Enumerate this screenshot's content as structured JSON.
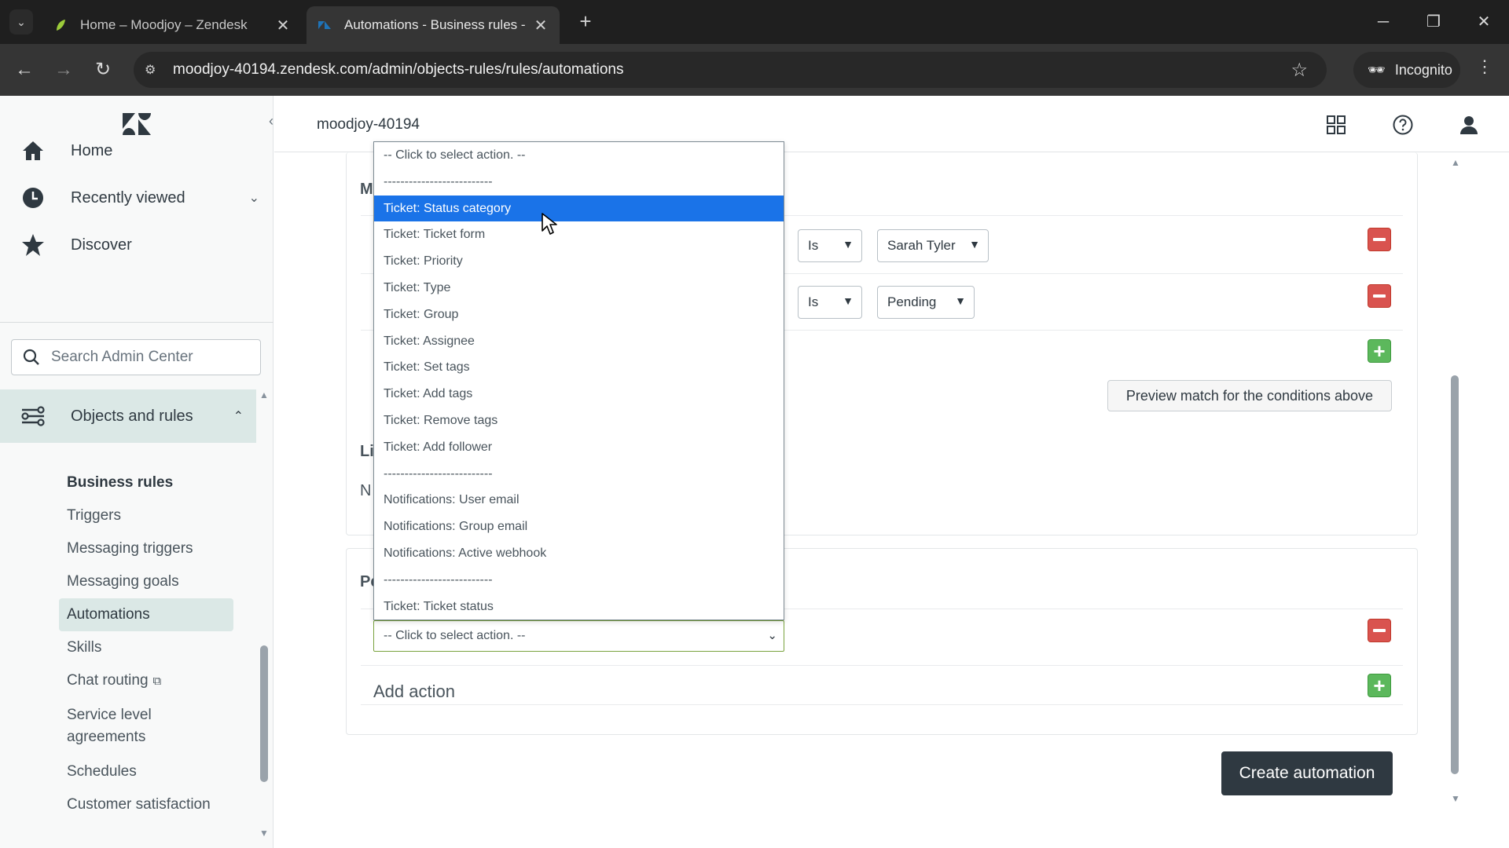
{
  "browser": {
    "tabs": [
      {
        "title": "Home – Moodjoy – Zendesk",
        "active": false
      },
      {
        "title": "Automations - Business rules -",
        "active": true
      }
    ],
    "url": "moodjoy-40194.zendesk.com/admin/objects-rules/rules/automations",
    "incognito_label": "Incognito"
  },
  "sidebar": {
    "nav": [
      {
        "label": "Home",
        "icon": "home-icon"
      },
      {
        "label": "Recently viewed",
        "icon": "clock-icon"
      },
      {
        "label": "Discover",
        "icon": "star-icon"
      }
    ],
    "search_placeholder": "Search Admin Center",
    "section": {
      "label": "Objects and rules",
      "icon": "objects-rules-icon"
    },
    "sub_heading": "Business rules",
    "sub_items": [
      {
        "label": "Triggers"
      },
      {
        "label": "Messaging triggers"
      },
      {
        "label": "Messaging goals"
      },
      {
        "label": "Automations",
        "selected": true
      },
      {
        "label": "Skills"
      },
      {
        "label": "Chat routing"
      },
      {
        "label": "Service level"
      },
      {
        "label": "agreements"
      },
      {
        "label": "Schedules"
      },
      {
        "label": "Customer satisfaction"
      }
    ]
  },
  "header": {
    "account": "moodjoy-40194"
  },
  "conditions": {
    "heading_fragment": "M",
    "rows": [
      {
        "operator": "Is",
        "value": "Sarah Tyler"
      },
      {
        "operator": "Is",
        "value": "Pending"
      }
    ],
    "preview_button": "Preview match for the conditions above",
    "limit_fragment": "Li",
    "note_fragment": "N"
  },
  "actions": {
    "heading_fragment": "Pe",
    "select_value": "-- Click to select action. --",
    "add_action_label": "Add action"
  },
  "dropdown": {
    "options": [
      "-- Click to select action. --",
      "--------------------------",
      "Ticket: Status category",
      "Ticket: Ticket form",
      "Ticket: Priority",
      "Ticket: Type",
      "Ticket: Group",
      "Ticket: Assignee",
      "Ticket: Set tags",
      "Ticket: Add tags",
      "Ticket: Remove tags",
      "Ticket: Add follower",
      "--------------------------",
      "Notifications: User email",
      "Notifications: Group email",
      "Notifications: Active webhook",
      "--------------------------",
      "Ticket: Ticket status"
    ],
    "highlighted": "Ticket: Status category"
  },
  "create_button": "Create automation",
  "colors": {
    "selected_bg": "#dbe8e6",
    "dropdown_highlight": "#1a73e8",
    "remove": "#d9534f",
    "add": "#5cb85c",
    "primary_dark": "#2f3941"
  }
}
